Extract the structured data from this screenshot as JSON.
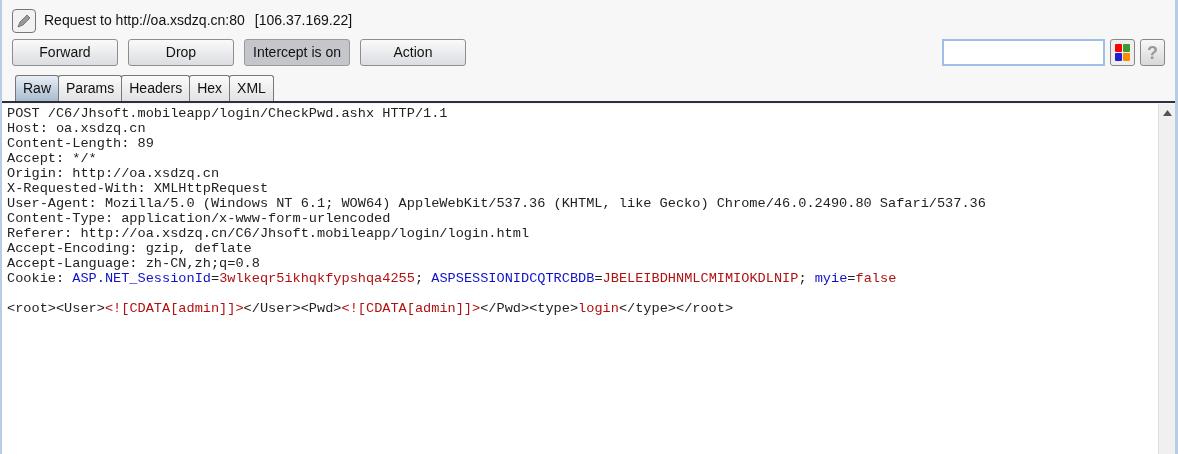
{
  "header": {
    "title": "Request to http://oa.xsdzq.cn:80",
    "address": "[106.37.169.22]"
  },
  "buttons": [
    {
      "label": "Forward",
      "on": false
    },
    {
      "label": "Drop",
      "on": false
    },
    {
      "label": "Intercept is on",
      "on": true
    },
    {
      "label": "Action",
      "on": false
    }
  ],
  "help": {
    "label": "?"
  },
  "tabs": [
    {
      "label": "Raw",
      "selected": true
    },
    {
      "label": "Params",
      "selected": false
    },
    {
      "label": "Headers",
      "selected": false
    },
    {
      "label": "Hex",
      "selected": false
    },
    {
      "label": "XML",
      "selected": false
    }
  ],
  "request_headers": [
    {
      "segments": [
        {
          "kind": "plain",
          "text": "POST /C6/Jhsoft.mobileapp/login/CheckPwd.ashx HTTP/1.1"
        }
      ]
    },
    {
      "segments": [
        {
          "kind": "plain",
          "text": "Host: oa.xsdzq.cn"
        }
      ]
    },
    {
      "segments": [
        {
          "kind": "plain",
          "text": "Content-Length: 89"
        }
      ]
    },
    {
      "segments": [
        {
          "kind": "plain",
          "text": "Accept: */*"
        }
      ]
    },
    {
      "segments": [
        {
          "kind": "plain",
          "text": "Origin: http://oa.xsdzq.cn"
        }
      ]
    },
    {
      "segments": [
        {
          "kind": "plain",
          "text": "X-Requested-With: XMLHttpRequest"
        }
      ]
    },
    {
      "segments": [
        {
          "kind": "plain",
          "text": "User-Agent: Mozilla/5.0 (Windows NT 6.1; WOW64) AppleWebKit/537.36 (KHTML, like Gecko) Chrome/46.0.2490.80 Safari/537.36"
        }
      ]
    },
    {
      "segments": [
        {
          "kind": "plain",
          "text": "Content-Type: application/x-www-form-urlencoded"
        }
      ]
    },
    {
      "segments": [
        {
          "kind": "plain",
          "text": "Referer: http://oa.xsdzq.cn/C6/Jhsoft.mobileapp/login/login.html"
        }
      ]
    },
    {
      "segments": [
        {
          "kind": "plain",
          "text": "Accept-Encoding: gzip, deflate"
        }
      ]
    },
    {
      "segments": [
        {
          "kind": "plain",
          "text": "Accept-Language: zh-CN,zh;q=0.8"
        }
      ]
    },
    {
      "segments": [
        {
          "kind": "plain",
          "text": "Cookie: "
        },
        {
          "kind": "name",
          "text": "ASP.NET_SessionId"
        },
        {
          "kind": "plain",
          "text": "="
        },
        {
          "kind": "value",
          "text": "3wlkeqr5ikhqkfypshqa4255"
        },
        {
          "kind": "plain",
          "text": "; "
        },
        {
          "kind": "name",
          "text": "ASPSESSIONIDCQTRCBDB"
        },
        {
          "kind": "plain",
          "text": "="
        },
        {
          "kind": "value",
          "text": "JBELEIBDHNMLCMIMIOKDLNIP"
        },
        {
          "kind": "plain",
          "text": "; "
        },
        {
          "kind": "name",
          "text": "myie"
        },
        {
          "kind": "plain",
          "text": "="
        },
        {
          "kind": "value",
          "text": "false"
        }
      ]
    }
  ],
  "request_body": [
    {
      "segments": [
        {
          "kind": "plain",
          "text": "<root><User>"
        },
        {
          "kind": "value",
          "text": "<![CDATA[admin]]>"
        },
        {
          "kind": "plain",
          "text": "</User><Pwd>"
        },
        {
          "kind": "value",
          "text": "<![CDATA[admin]]>"
        },
        {
          "kind": "plain",
          "text": "</Pwd><type>"
        },
        {
          "kind": "value",
          "text": "login"
        },
        {
          "kind": "plain",
          "text": "</type></root>"
        }
      ]
    }
  ]
}
